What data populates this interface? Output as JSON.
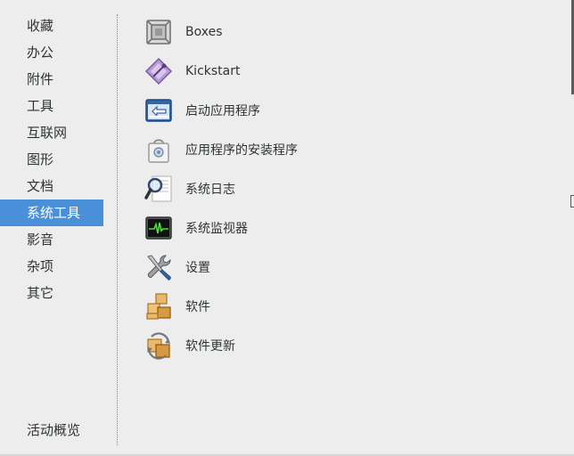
{
  "sidebar": {
    "categories": [
      {
        "label": "收藏"
      },
      {
        "label": "办公"
      },
      {
        "label": "附件"
      },
      {
        "label": "工具"
      },
      {
        "label": "互联网"
      },
      {
        "label": "图形"
      },
      {
        "label": "文档"
      },
      {
        "label": "系统工具",
        "selected": true
      },
      {
        "label": "影音"
      },
      {
        "label": "杂项"
      },
      {
        "label": "其它"
      }
    ],
    "overview_label": "活动概览"
  },
  "apps": [
    {
      "label": "Boxes",
      "icon": "boxes-icon"
    },
    {
      "label": "Kickstart",
      "icon": "kickstart-icon"
    },
    {
      "label": "启动应用程序",
      "icon": "startup-applications-icon"
    },
    {
      "label": "应用程序的安装程序",
      "icon": "app-installer-icon"
    },
    {
      "label": "系统日志",
      "icon": "system-log-icon"
    },
    {
      "label": "系统监视器",
      "icon": "system-monitor-icon"
    },
    {
      "label": "设置",
      "icon": "settings-icon"
    },
    {
      "label": "软件",
      "icon": "software-icon"
    },
    {
      "label": "软件更新",
      "icon": "software-update-icon"
    }
  ],
  "colors": {
    "selection": "#4a90d9",
    "background": "#ededed",
    "text": "#2e3436"
  }
}
